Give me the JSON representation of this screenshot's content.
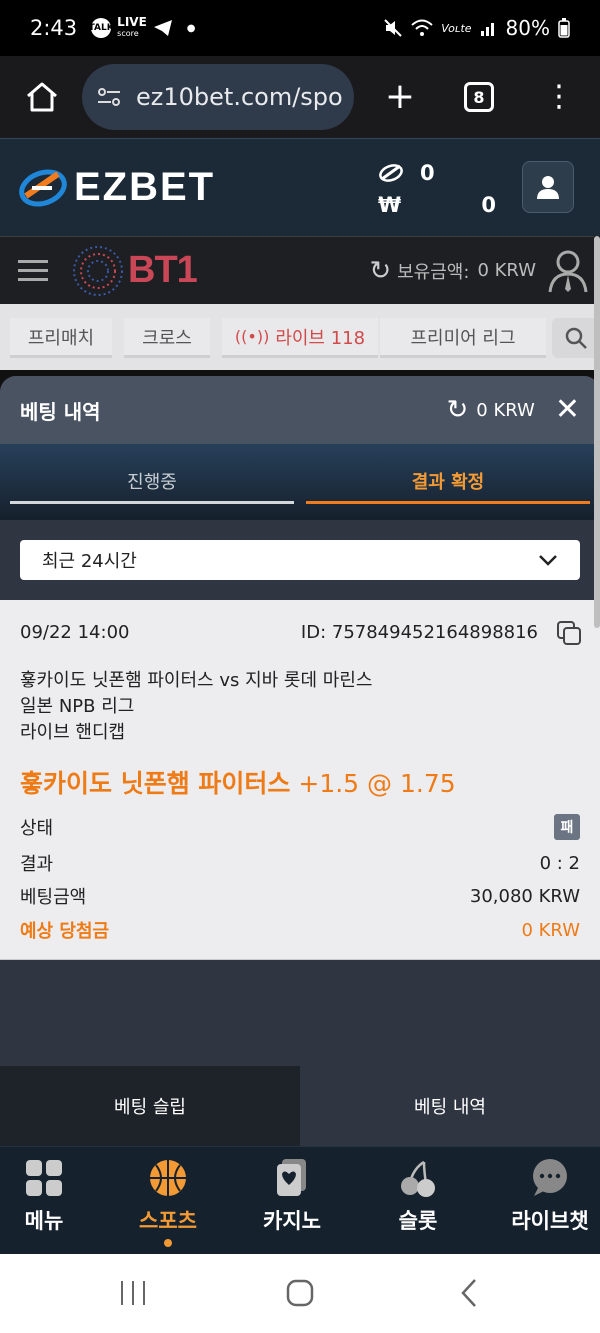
{
  "status_bar": {
    "time": "2:43",
    "talk": "TALK",
    "live": "LIVE",
    "live_sub": "score",
    "network": "Voʟte",
    "battery": "80%"
  },
  "browser": {
    "url": "ez10bet.com/spo",
    "tab_count": "8"
  },
  "header": {
    "logo": "EZBET",
    "balance_points": "0",
    "currency_symbol": "₩",
    "balance_krw": "0"
  },
  "sub_header": {
    "bt1_logo": "BT1",
    "holding_label": "보유금액:",
    "holding_value": "0 KRW"
  },
  "category_tabs": [
    {
      "label": "프리매치"
    },
    {
      "label": "크로스"
    },
    {
      "label": "라이브 118"
    },
    {
      "label": "프리미어 리그"
    }
  ],
  "modal": {
    "title": "베팅 내역",
    "balance": "0 KRW",
    "tabs": {
      "in_progress": "진행중",
      "settled": "결과 확정"
    },
    "filter": {
      "selected": "최근 24시간"
    },
    "bet": {
      "datetime": "09/22 14:00",
      "id": "ID: 757849452164898816",
      "match": "훃카이도 닛폰햄 파이터스 vs 지바 롯데 마린스",
      "league": "일본 NPB 리그",
      "market": "라이브 핸디캡",
      "pick_team": "훃카이도 닛폰햄 파이터스",
      "pick_odds": "+1.5 @ 1.75",
      "status_label": "상태",
      "status_value": "패",
      "result_label": "결과",
      "result_value": "0 : 2",
      "amount_label": "베팅금액",
      "amount_value": "30,080 KRW",
      "expected_label": "예상 당첨금",
      "expected_value": "0 KRW"
    },
    "footer": {
      "slip": "베팅 슬립",
      "history": "베팅 내역"
    }
  },
  "bottom_nav": [
    {
      "label": "메뉴",
      "icon": "grid-icon"
    },
    {
      "label": "스포츠",
      "icon": "basketball-icon",
      "active": true
    },
    {
      "label": "카지노",
      "icon": "cards-icon"
    },
    {
      "label": "슬롯",
      "icon": "cherry-icon"
    },
    {
      "label": "라이브챗",
      "icon": "chat-icon"
    }
  ],
  "colors": {
    "accent": "#ef7b16",
    "header_bg": "#1c2a37",
    "modal_bg": "#2f3541",
    "live_red": "#d24b4b"
  }
}
